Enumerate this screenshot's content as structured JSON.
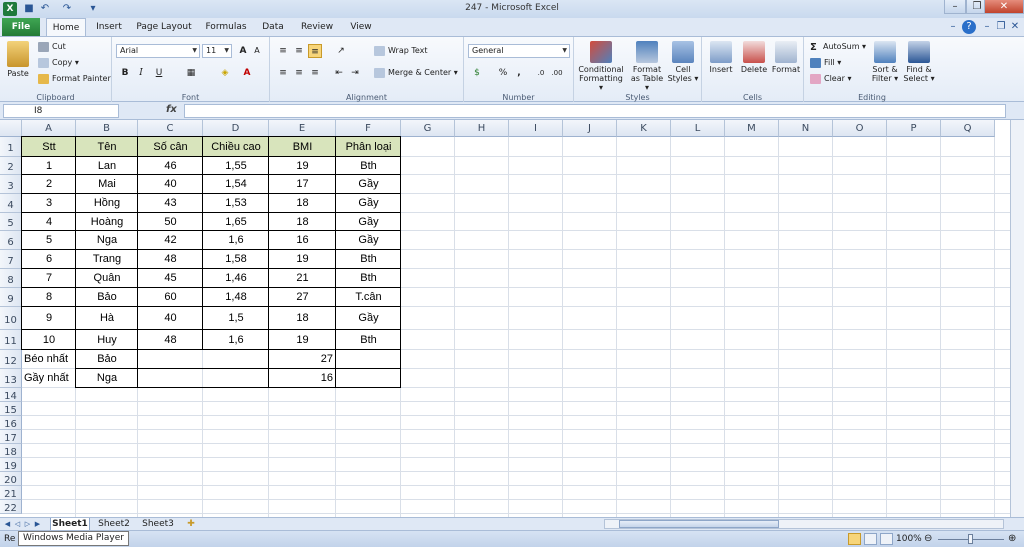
{
  "window": {
    "title": "247  -  Microsoft Excel",
    "app_icon": "X",
    "controls": [
      "–",
      "❐",
      "✕"
    ],
    "ribbon_controls": [
      "–",
      "?",
      "–",
      "❐",
      "✕"
    ]
  },
  "ribbon_tabs": {
    "file": "File",
    "tabs": [
      "Home",
      "Insert",
      "Page Layout",
      "Formulas",
      "Data",
      "Review",
      "View"
    ],
    "active": "Home"
  },
  "ribbon": {
    "clipboard": {
      "paste": "Paste",
      "cut": "Cut",
      "copy": "Copy ▾",
      "format_painter": "Format Painter",
      "label": "Clipboard"
    },
    "font": {
      "name": "Arial",
      "size": "11",
      "bold": "B",
      "italic": "I",
      "underline": "U",
      "grow": "A",
      "shrink": "A",
      "label": "Font"
    },
    "alignment": {
      "wrap_text": "Wrap Text",
      "merge_center": "Merge & Center ▾",
      "label": "Alignment"
    },
    "number": {
      "format": "General",
      "percent": "%",
      "comma": ",",
      "label": "Number"
    },
    "styles": {
      "conditional": "Conditional",
      "formatting": "Formatting ▾",
      "format": "Format",
      "as_table": "as Table ▾",
      "cell": "Cell",
      "cell_styles": "Styles ▾",
      "label": "Styles"
    },
    "cells": {
      "insert": "Insert",
      "delete": "Delete",
      "format": "Format",
      "label": "Cells"
    },
    "editing": {
      "autosum": "AutoSum ▾",
      "fill": "Fill ▾",
      "clear": "Clear ▾",
      "sort": "Sort &",
      "filter": "Filter ▾",
      "find": "Find &",
      "select": "Select ▾",
      "label": "Editing"
    }
  },
  "formula_bar": {
    "name_box": "I8",
    "fx": "fx",
    "value": ""
  },
  "columns": [
    "A",
    "B",
    "C",
    "D",
    "E",
    "F",
    "G",
    "H",
    "I",
    "J",
    "K",
    "L",
    "M",
    "N",
    "O",
    "P",
    "Q"
  ],
  "rows": [
    "1",
    "2",
    "3",
    "4",
    "5",
    "6",
    "7",
    "8",
    "9",
    "10",
    "11",
    "12",
    "13",
    "14",
    "15",
    "16",
    "17",
    "18",
    "19",
    "20",
    "21",
    "22"
  ],
  "table": {
    "headers": [
      "Stt",
      "Tên",
      "Số cân",
      "Chiều cao",
      "BMI",
      "Phân loại"
    ],
    "rows": [
      [
        "1",
        "Lan",
        "46",
        "1,55",
        "19",
        "Bth"
      ],
      [
        "2",
        "Mai",
        "40",
        "1,54",
        "17",
        "Gầy"
      ],
      [
        "3",
        "Hồng",
        "43",
        "1,53",
        "18",
        "Gầy"
      ],
      [
        "4",
        "Hoàng",
        "50",
        "1,65",
        "18",
        "Gầy"
      ],
      [
        "5",
        "Nga",
        "42",
        "1,6",
        "16",
        "Gầy"
      ],
      [
        "6",
        "Trang",
        "48",
        "1,58",
        "19",
        "Bth"
      ],
      [
        "7",
        "Quân",
        "45",
        "1,46",
        "21",
        "Bth"
      ],
      [
        "8",
        "Bảo",
        "60",
        "1,48",
        "27",
        "T.cân"
      ],
      [
        "9",
        "Hà",
        "40",
        "1,5",
        "18",
        "Gầy"
      ],
      [
        "10",
        "Huy",
        "48",
        "1,6",
        "19",
        "Bth"
      ]
    ],
    "summary": [
      {
        "label": "Béo nhất",
        "name": "Bảo",
        "bmi": "27"
      },
      {
        "label": "Gầy nhất",
        "name": "Nga",
        "bmi": "16"
      }
    ]
  },
  "sheets": {
    "tabs": [
      "Sheet1",
      "Sheet2",
      "Sheet3"
    ],
    "active": "Sheet1"
  },
  "status": {
    "ready": "Re",
    "tooltip": "Windows Media Player",
    "zoom": "100%"
  },
  "colors": {
    "header_fill": "#d8e4bc",
    "file_tab": "#237b36",
    "accent": "#2a5695"
  }
}
